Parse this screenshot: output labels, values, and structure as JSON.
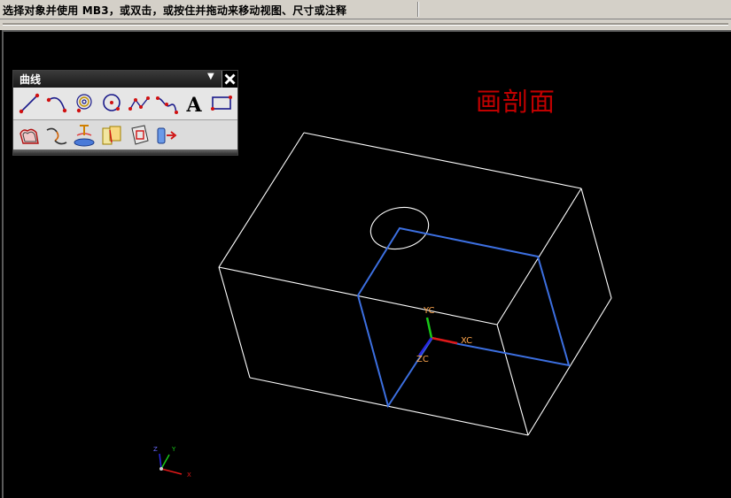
{
  "status_bar": {
    "prompt": "选择对象并使用 MB3，或双击，或按住并拖动来移动视图、尺寸或注释"
  },
  "toolbar": {
    "title": "曲线",
    "menu_glyph": "▼",
    "close_glyph": "✕",
    "text_tool_glyph": "A",
    "row1": [
      "line-icon",
      "arc-icon",
      "spiral-icon",
      "circle-icon",
      "studio-spline-icon",
      "spline-icon",
      "text-icon",
      "rectangle-icon"
    ],
    "row2": [
      "offset-curve-icon",
      "bridge-curve-icon",
      "projected-curve-icon",
      "intersection-curve-icon",
      "section-curve-icon",
      "extract-curve-icon"
    ]
  },
  "viewport": {
    "annotation": "画剖面",
    "annotation_color": "#c00000",
    "wcs": {
      "x_label": "XC",
      "y_label": "YC",
      "z_label": "ZC"
    },
    "view_triad": {
      "x_label": "X",
      "y_label": "Y",
      "z_label": "Z"
    }
  },
  "colors": {
    "background": "#000000",
    "model_edges": "#ffffff",
    "section_sketch": "#3c6fe0",
    "x_axis": "#e01818",
    "y_axis": "#18c818",
    "z_axis": "#2828e0",
    "axis_label": "#ffa64d"
  }
}
